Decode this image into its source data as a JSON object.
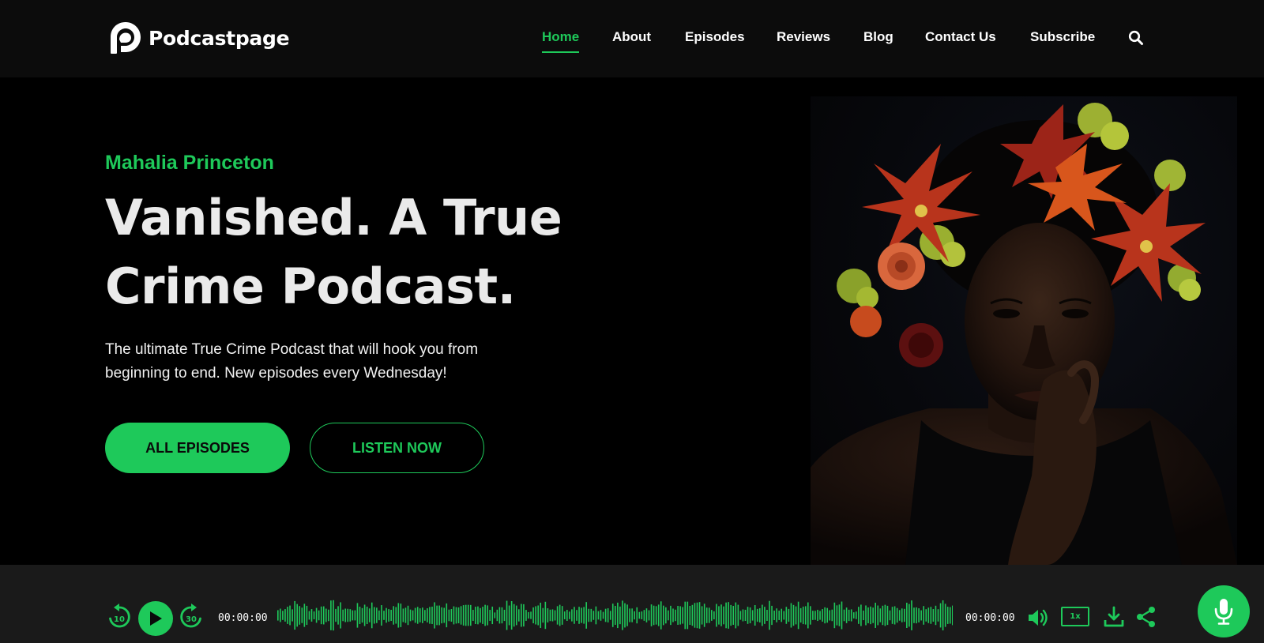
{
  "brand": {
    "name": "Podcastpage",
    "accent": "#1ec95a"
  },
  "nav": {
    "items": [
      {
        "label": "Home",
        "active": true
      },
      {
        "label": "About",
        "active": false
      },
      {
        "label": "Episodes",
        "active": false
      },
      {
        "label": "Reviews",
        "active": false
      },
      {
        "label": "Blog",
        "active": false
      },
      {
        "label": "Contact Us",
        "active": false
      },
      {
        "label": "Subscribe",
        "active": false
      }
    ],
    "search_icon": "search-icon"
  },
  "hero": {
    "host": "Mahalia Princeton",
    "title_line1": "Vanished. A True",
    "title_line2": "Crime Podcast.",
    "description_line1": "The ultimate True Crime Podcast that will hook you from",
    "description_line2": "beginning to end. New episodes every Wednesday!",
    "primary_button": "ALL EPISODES",
    "secondary_button": "LISTEN NOW"
  },
  "player": {
    "rewind_seconds": "10",
    "forward_seconds": "30",
    "current_time": "00:00:00",
    "duration": "00:00:00",
    "speed": "1x",
    "progress": 0,
    "icons": [
      "rewind-icon",
      "play-icon",
      "forward-icon",
      "volume-icon",
      "download-icon",
      "share-icon",
      "microphone-icon"
    ]
  }
}
